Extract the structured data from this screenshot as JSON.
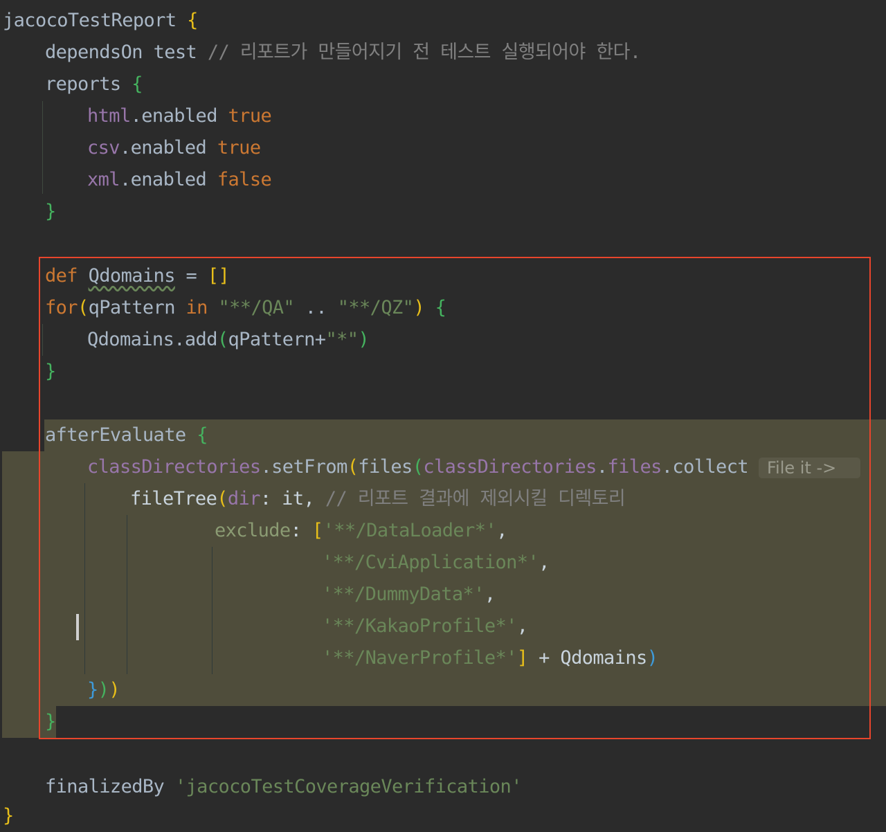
{
  "lines": {
    "l1": {
      "name": "jacocoTestReport",
      "brace": "{"
    },
    "l2": {
      "kw": "dependsOn",
      "arg": "test",
      "comment": "// 리포트가 만들어지기 전 테스트 실행되어야 한다."
    },
    "l3": {
      "kw": "reports",
      "brace": "{"
    },
    "l4": {
      "prop": "html",
      "dot_enabled": ".enabled",
      "val": "true"
    },
    "l5": {
      "prop": "csv",
      "dot_enabled": ".enabled",
      "val": "true"
    },
    "l6": {
      "prop": "xml",
      "dot_enabled": ".enabled",
      "val": "false"
    },
    "l7": {
      "brace": "}"
    },
    "l8": {
      "def": "def",
      "var": "Qdomains",
      "assign": " = ",
      "list": "[]"
    },
    "l9": {
      "for": "for",
      "open": "(",
      "var": "qPattern",
      "in": "in",
      "s1": "\"**/QA\"",
      "range": " .. ",
      "s2": "\"**/QZ\"",
      "close": ")",
      "brace": "{"
    },
    "l10": {
      "call": "Qdomains.add",
      "open": "(",
      "arg": "qPattern+",
      "str": "\"*\"",
      "close": ")"
    },
    "l11": {
      "brace": "}"
    },
    "l12": {
      "kw": "afterEvaluate",
      "brace": "{"
    },
    "l13": {
      "p1": "classDirectories",
      "m1": ".setFrom",
      "o1": "(",
      "f": "files",
      "o2": "(",
      "p2": "classDirectories",
      "dot": ".",
      "p3": "files",
      "m2": ".collect",
      "brace": "{"
    },
    "l14": {
      "f": "fileTree",
      "o": "(",
      "lbl": "dir",
      "colon": ":",
      "arg": " it,",
      "comment": "// 리포트 결과에 제외시킬 디렉토리"
    },
    "l15": {
      "lbl": "exclude",
      "colon": ":",
      "ob": "[",
      "str": "'**/DataLoader*'",
      "comma": ","
    },
    "l16": {
      "str": "'**/CviApplication*'",
      "comma": ","
    },
    "l17": {
      "str": "'**/DummyData*'",
      "comma": ","
    },
    "l18": {
      "str": "'**/KakaoProfile*'",
      "comma": ","
    },
    "l19": {
      "str": "'**/NaverProfile*'",
      "cb": "]",
      "plus": " + ",
      "var": "Qdomains",
      "close": ")"
    },
    "l20": {
      "c1": "}",
      "c2": ")",
      "c3": ")"
    },
    "l21": {
      "brace": "}"
    },
    "l22": {
      "kw": "finalizedBy",
      "str": "'jacocoTestCoverageVerification'"
    },
    "l23": {
      "brace": "}"
    }
  },
  "inlay_hint": "File it ->",
  "colors": {
    "background": "#2b2b2b",
    "keyword": "#cc7832",
    "property": "#9876aa",
    "comment": "#808080",
    "string": "#6a8759",
    "identifier": "#a9b7c6",
    "selection": "#4f4d3b",
    "annotation_box": "#e8452c"
  }
}
